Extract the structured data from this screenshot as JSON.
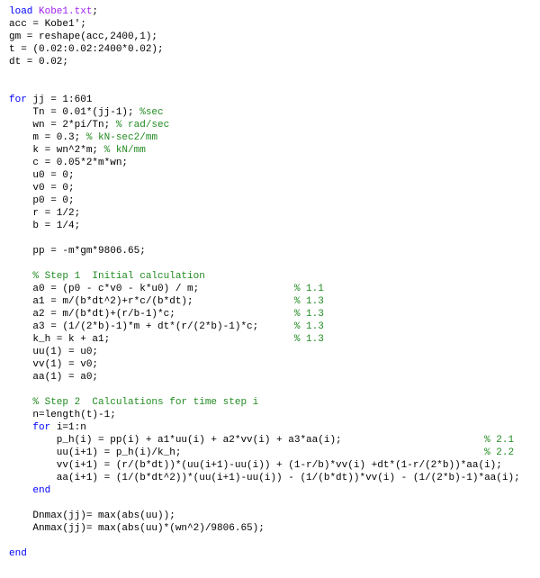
{
  "code": {
    "l1": {
      "kw": "load",
      "str": " Kobe1.txt",
      "tail": ";"
    },
    "l2": "acc = Kobe1';",
    "l3": "gm = reshape(acc,2400,1);",
    "l4": "t = (0.02:0.02:2400*0.02);",
    "l5": "dt = 0.02;",
    "l9a": {
      "kw": "for",
      "tail": " jj = 1:601"
    },
    "l10": {
      "ind": "    ",
      "body": "Tn = 0.01*(jj-1); ",
      "com": "%sec"
    },
    "l11": {
      "ind": "    ",
      "body": "wn = 2*pi/Tn; ",
      "com": "% rad/sec"
    },
    "l12": {
      "ind": "    ",
      "body": "m = 0.3; ",
      "com": "% kN-sec2/mm"
    },
    "l13": {
      "ind": "    ",
      "body": "k = wn^2*m; ",
      "com": "% kN/mm"
    },
    "l14": "    c = 0.05*2*m*wn;",
    "l15": "    u0 = 0;",
    "l16": "    v0 = 0;",
    "l17": "    p0 = 0;",
    "l18": "    r = 1/2;",
    "l19": "    b = 1/4;",
    "l21": "    pp = -m*gm*9806.65;",
    "c1": "    % Step 1  Initial calculation",
    "l24": {
      "body": "    a0 = (p0 - c*v0 - k*u0) / m;                ",
      "com": "% 1.1"
    },
    "l25": {
      "body": "    a1 = m/(b*dt^2)+r*c/(b*dt);                 ",
      "com": "% 1.3"
    },
    "l26": {
      "body": "    a2 = m/(b*dt)+(r/b-1)*c;                    ",
      "com": "% 1.3"
    },
    "l27": {
      "body": "    a3 = (1/(2*b)-1)*m + dt*(r/(2*b)-1)*c;      ",
      "com": "% 1.3"
    },
    "l28": {
      "body": "    k_h = k + a1;                               ",
      "com": "% 1.3"
    },
    "l29": "    uu(1) = u0;",
    "l30": "    vv(1) = v0;",
    "l31": "    aa(1) = a0;",
    "c2": "    % Step 2  Calculations for time step i",
    "l34": "    n=length(t)-1;",
    "l35": {
      "ind": "    ",
      "kw": "for",
      "tail": " i=1:n"
    },
    "l36": {
      "body": "        p_h(i) = pp(i) + a1*uu(i) + a2*vv(i) + a3*aa(i);                        ",
      "com": "% 2.1"
    },
    "l37": {
      "body": "        uu(i+1) = p_h(i)/k_h;                                                   ",
      "com": "% 2.2"
    },
    "l38": "        vv(i+1) = (r/(b*dt))*(uu(i+1)-uu(i)) + (1-r/b)*vv(i) +dt*(1-r/(2*b))*aa(i);",
    "l39": "        aa(i+1) = (1/(b*dt^2))*(uu(i+1)-uu(i)) - (1/(b*dt))*vv(i) - (1/(2*b)-1)*aa(i);",
    "l40": {
      "ind": "    ",
      "kw": "end"
    },
    "l42": "    Dnmax(jj)= max(abs(uu));",
    "l43": "    Anmax(jj)= max(abs(uu)*(wn^2)/9806.65);",
    "l45": {
      "kw": "end"
    }
  }
}
